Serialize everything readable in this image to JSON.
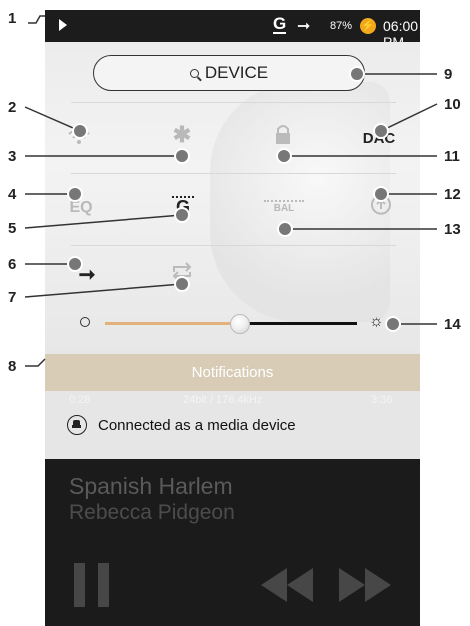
{
  "status_bar": {
    "battery": "87%",
    "time": "06:00 PM",
    "gapless_icon": "G",
    "output_icon": "arrow-right"
  },
  "panel": {
    "device_button": "DEVICE",
    "icons": {
      "wifi": "wifi-icon",
      "bluetooth": "bluetooth-icon",
      "lock": "lock-icon",
      "dac": "DAC",
      "eq": "EQ",
      "gapless": "G",
      "bal": "BAL",
      "update": "update-icon",
      "line_out": "arrow-right",
      "repeat": "repeat-icon"
    }
  },
  "notifications": {
    "title": "Notifications",
    "ghost_elapsed": "0:28",
    "ghost_format": "24bit / 176.4kHz",
    "ghost_total": "3:36",
    "message": "Connected as a media device"
  },
  "player": {
    "song": "Spanish Harlem",
    "artist": "Rebecca Pidgeon"
  },
  "brightness": {
    "value": 0.53
  },
  "callouts": [
    "1",
    "2",
    "3",
    "4",
    "5",
    "6",
    "7",
    "8",
    "9",
    "10",
    "11",
    "12",
    "13",
    "14"
  ]
}
